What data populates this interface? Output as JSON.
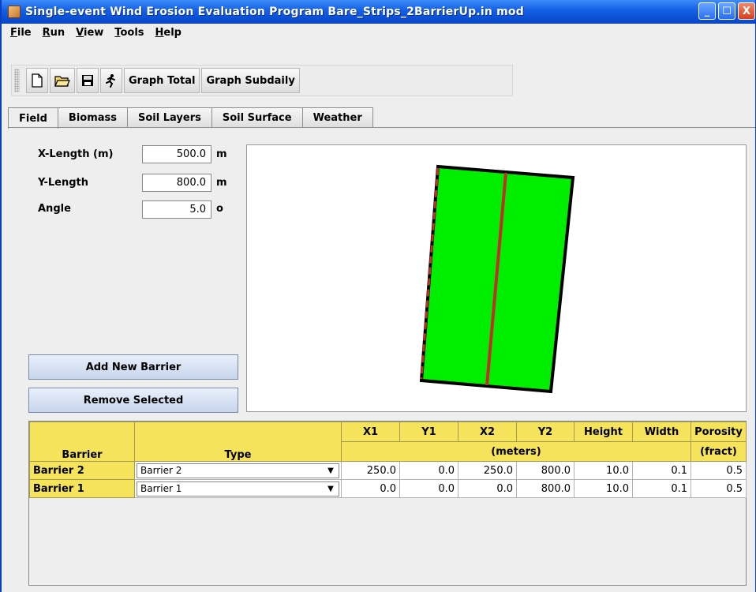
{
  "window": {
    "title": "Single-event Wind Erosion Evaluation Program Bare_Strips_2BarrierUp.in mod",
    "min_glyph": "_",
    "max_glyph": "☐",
    "close_glyph": "X"
  },
  "menu": [
    {
      "key": "F",
      "rest": "ile"
    },
    {
      "key": "R",
      "rest": "un"
    },
    {
      "key": "V",
      "rest": "iew"
    },
    {
      "key": "T",
      "rest": "ools"
    },
    {
      "key": "H",
      "rest": "elp"
    }
  ],
  "toolbar": {
    "graph_total": "Graph Total",
    "graph_subdaily": "Graph Subdaily"
  },
  "tabs": [
    "Field",
    "Biomass",
    "Soil Layers",
    "Soil Surface",
    "Weather"
  ],
  "field": {
    "x_label": "X-Length (m)",
    "x_value": "500.0",
    "x_unit": "m",
    "y_label": "Y-Length",
    "y_value": "800.0",
    "y_unit": "m",
    "angle_label": "Angle",
    "angle_value": "5.0",
    "angle_unit": "o"
  },
  "buttons": {
    "add_barrier": "Add New Barrier",
    "remove_selected": "Remove Selected"
  },
  "colors": {
    "field_fill": "#00ee00",
    "barrier": "#c0302a",
    "header_yellow": "#f6e35c"
  },
  "table": {
    "headers_top": [
      "X1",
      "Y1",
      "X2",
      "Y2",
      "Height",
      "Width",
      "Porosity"
    ],
    "header_barrier": "Barrier",
    "header_type": "Type",
    "header_units": "(meters)",
    "header_fract": "(fract)",
    "rows": [
      {
        "name": "Barrier 2",
        "type": "Barrier 2",
        "x1": "250.0",
        "y1": "0.0",
        "x2": "250.0",
        "y2": "800.0",
        "height": "10.0",
        "width": "0.1",
        "porosity": "0.5"
      },
      {
        "name": "Barrier 1",
        "type": "Barrier 1",
        "x1": "0.0",
        "y1": "0.0",
        "x2": "0.0",
        "y2": "800.0",
        "height": "10.0",
        "width": "0.1",
        "porosity": "0.5"
      }
    ]
  }
}
